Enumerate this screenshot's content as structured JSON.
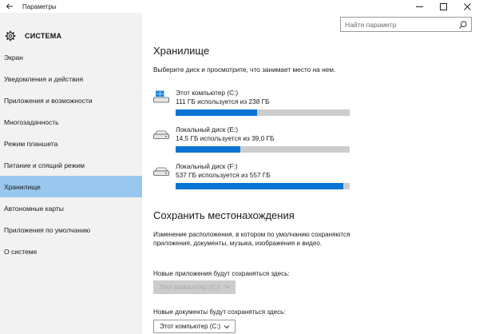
{
  "window": {
    "title": "Параметры",
    "back_icon": "back-arrow-icon",
    "controls": [
      "minimize-icon",
      "maximize-icon",
      "close-icon"
    ]
  },
  "header": {
    "section_label": "СИСТЕМА",
    "section_icon": "gear-icon"
  },
  "search": {
    "placeholder": "Найти параметр",
    "icon": "search-icon"
  },
  "sidebar": {
    "items": [
      {
        "label": "Экран",
        "active": false
      },
      {
        "label": "Уведомления и действия",
        "active": false
      },
      {
        "label": "Приложения и возможности",
        "active": false
      },
      {
        "label": "Многозадачность",
        "active": false
      },
      {
        "label": "Режим планшета",
        "active": false
      },
      {
        "label": "Питание и спящий режим",
        "active": false
      },
      {
        "label": "Хранилище",
        "active": true
      },
      {
        "label": "Автономные карты",
        "active": false
      },
      {
        "label": "Приложения по умолчанию",
        "active": false
      },
      {
        "label": "О системе",
        "active": false
      }
    ]
  },
  "storage": {
    "title": "Хранилище",
    "subtitle": "Выберите диск и просмотрите, что занимает место на нем.",
    "drives": [
      {
        "name": "Этот компьютер (C:)",
        "usage": "111 ГБ используется из 238 ГБ",
        "used_fraction": 0.466,
        "icon": "windows-drive-icon"
      },
      {
        "name": "Локальный диск (E:)",
        "usage": "14,5 ГБ используется из 39,0 ГБ",
        "used_fraction": 0.372,
        "icon": "hard-drive-icon"
      },
      {
        "name": "Локальный диск (F:)",
        "usage": "537 ГБ используется из 557 ГБ",
        "used_fraction": 0.964,
        "icon": "hard-drive-icon"
      }
    ]
  },
  "save_locations": {
    "title": "Сохранить местонахождения",
    "description": "Изменение расположения, в котором по умолчанию сохраняются приложения, документы, музыка, изображения и видео.",
    "apps_label": "Новые приложения будут сохраняться здесь:",
    "apps_value": "Этот компьютер (C:)",
    "docs_label": "Новые документы будут сохраняться здесь:",
    "docs_value": "Этот компьютер (C:)"
  },
  "colors": {
    "accent": "#0a74d2",
    "active_nav": "#99c7ef",
    "sidebar_bg": "#f2f2f2",
    "bar_bg": "#cccccc"
  }
}
